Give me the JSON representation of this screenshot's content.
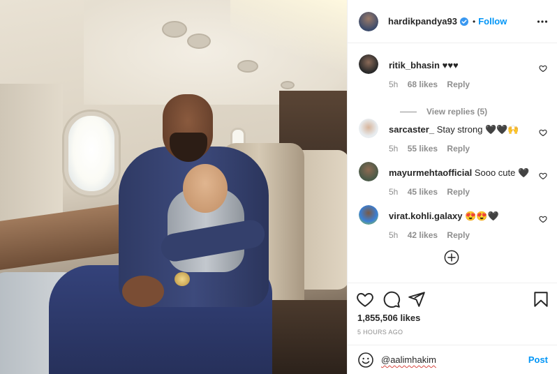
{
  "post": {
    "username": "hardikpandya93",
    "verified": true,
    "follow_label": "Follow",
    "dot": "•",
    "more_icon": "more-horizontal-icon",
    "likes": "1,855,506 likes",
    "time_ago": "5 HOURS AGO"
  },
  "comments": [
    {
      "username": "ritik_bhasin",
      "text": "♥♥♥",
      "time": "5h",
      "likes": "68 likes",
      "reply": "Reply",
      "avatar_color": "#2b2b2b"
    },
    {
      "username": "sarcaster_",
      "text": "Stay strong 🖤🖤🙌",
      "time": "5h",
      "likes": "55 likes",
      "reply": "Reply",
      "avatar_color": "#cfd8dc"
    },
    {
      "username": "mayurmehtaofficial",
      "text": "Sooo cute 🖤",
      "time": "5h",
      "likes": "45 likes",
      "reply": "Reply",
      "avatar_color": "#6d7d6a"
    },
    {
      "username": "virat.kohli.galaxy",
      "text": "😍😍🖤",
      "time": "5h",
      "likes": "42 likes",
      "reply": "Reply",
      "avatar_color": "#3b7fd4"
    }
  ],
  "view_replies": "View replies (5)",
  "composer": {
    "value": "@aalimhakim",
    "post_label": "Post"
  },
  "colors": {
    "accent": "#0095f6",
    "secondary_text": "#8e8e8e",
    "divider": "#efefef"
  }
}
